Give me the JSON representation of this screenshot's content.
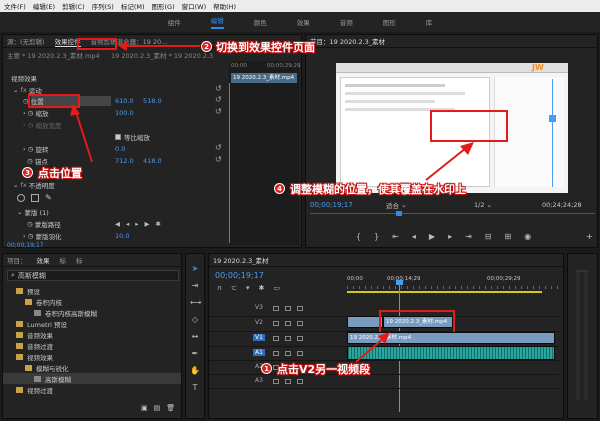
{
  "menu": [
    "文件(F)",
    "编辑(E)",
    "剪辑(C)",
    "序列(S)",
    "标记(M)",
    "图形(G)",
    "窗口(W)",
    "帮助(H)"
  ],
  "workspaces": [
    {
      "label": "组件",
      "active": false
    },
    {
      "label": "编辑",
      "active": true
    },
    {
      "label": "颜色",
      "active": false
    },
    {
      "label": "效果",
      "active": false
    },
    {
      "label": "音频",
      "active": false
    },
    {
      "label": "图形",
      "active": false
    },
    {
      "label": "库",
      "active": false
    }
  ],
  "effect_controls": {
    "tabs": [
      "源：(无剪辑)",
      "效果控件",
      "音频剪辑混合器：19 20..."
    ],
    "clip_path": "主要 * 19 2020.2.3_素材.mp4",
    "seq_path": "19 2020.2.3_素材 * 19 2020.2.3",
    "tl_start": "00;00",
    "tl_end": "00;00;29;29",
    "tl_clip": "19 2020.2.3_素材.mp4",
    "video_effects": "视频效果",
    "motion": "运动",
    "position": {
      "label": "位置",
      "x": "610.0",
      "y": "518.0"
    },
    "scale": {
      "label": "缩放",
      "value": "100.0"
    },
    "scale_width": "缩放宽度",
    "uniform_scale": "等比缩放",
    "rotation": {
      "label": "旋转",
      "value": "0.0"
    },
    "anchor": {
      "label": "锚点",
      "x": "712.0",
      "y": "418.0"
    },
    "opacity": "不透明度",
    "mask_path": "蒙版路径",
    "mask_feather": {
      "label": "蒙版羽化",
      "value": "10.0"
    },
    "timecode": "00;00;19;17"
  },
  "program": {
    "tabs": [
      "节目：19 2020.2.3_素材"
    ],
    "timecode": "00;00;19;17",
    "fit": "适合",
    "ratio": "1/2",
    "duration": "00;24;24;28",
    "watermark": "JW"
  },
  "project": {
    "tabs": [
      "项目：",
      "效果",
      "标",
      "标"
    ],
    "search_value": "高斯模糊",
    "tree": [
      {
        "label": "预设",
        "indent": 1,
        "type": "folder"
      },
      {
        "label": "卷积内核",
        "indent": 2,
        "type": "folder"
      },
      {
        "label": "卷积内核高斯模糊",
        "indent": 3,
        "type": "fx"
      },
      {
        "label": "Lumetri 预设",
        "indent": 1,
        "type": "folder"
      },
      {
        "label": "音频效果",
        "indent": 1,
        "type": "folder"
      },
      {
        "label": "音频过渡",
        "indent": 1,
        "type": "folder"
      },
      {
        "label": "视频效果",
        "indent": 1,
        "type": "folder"
      },
      {
        "label": "模糊与锐化",
        "indent": 2,
        "type": "folder"
      },
      {
        "label": "高斯模糊",
        "indent": 3,
        "type": "fx",
        "selected": true
      },
      {
        "label": "视频过渡",
        "indent": 1,
        "type": "folder"
      }
    ]
  },
  "timeline": {
    "tab": "19 2020.2.3_素材",
    "timecode": "00;00;19;17",
    "ruler": [
      "00;00",
      "00;00;14;29",
      "00;00;29;29"
    ],
    "tracks": [
      {
        "id": "V3",
        "kind": "video"
      },
      {
        "id": "V2",
        "kind": "video"
      },
      {
        "id": "V1",
        "kind": "video",
        "active": true
      },
      {
        "id": "A1",
        "kind": "audio",
        "active": true
      },
      {
        "id": "A2",
        "kind": "audio"
      },
      {
        "id": "A3",
        "kind": "audio"
      }
    ],
    "v2_clip": "19 2020.2.3_素材.mp4",
    "v1_clip": "19 2020.2.3_素材.mp4"
  },
  "annotations": {
    "a1": {
      "num": "1",
      "text": "点击V2另一视频段"
    },
    "a2": {
      "num": "2",
      "text": "切换到效果控件页面"
    },
    "a3": {
      "num": "3",
      "text": "点击位置"
    },
    "a4": {
      "num": "4",
      "text": "调整模糊的位置，使其覆盖在水印上"
    }
  },
  "colors": {
    "accent": "#2d8ceb",
    "annotation": "#e21b1b",
    "clip_video": "#7a9bc0",
    "clip_audio": "#2aa6a0"
  }
}
